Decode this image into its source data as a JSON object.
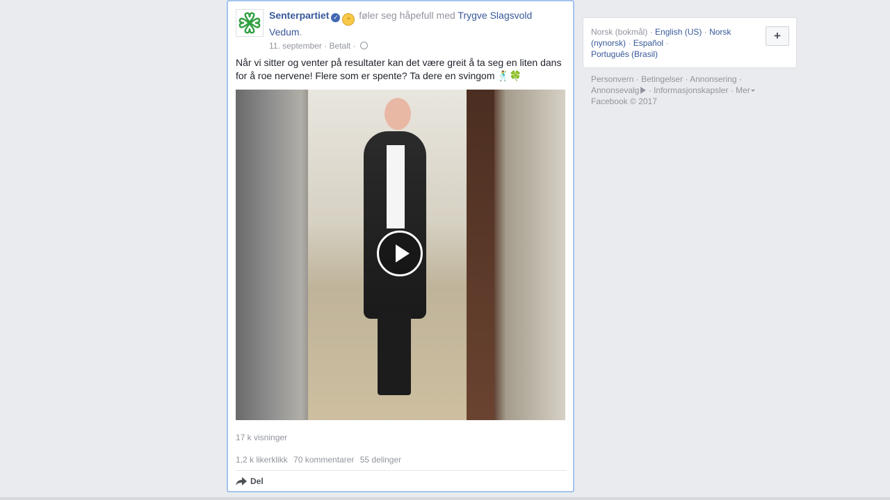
{
  "post": {
    "page_name": "Senterpartiet",
    "feeling_text": "føler seg håpefull med",
    "tagged_person": "Trygve Slagsvold Vedum",
    "tagged_suffix": ".",
    "date": "11. september",
    "sponsored": "Betalt",
    "dot": "·",
    "text": "Når vi sitter og venter på resultater kan det være greit å ta seg en liten dans for å roe nervene! Flere som er spente? Ta dere en svingom 🕺🍀",
    "views": "17 k visninger",
    "likes": "1,2 k likerklikk",
    "comments": "70 kommentarer",
    "shares": "55 delinger",
    "share_label": "Del",
    "icons": {
      "avatar": "clover-logo-icon",
      "verified": "verified-badge-icon",
      "feeling": "laughing-emoji-icon",
      "audience": "globe-icon",
      "play": "play-icon",
      "share": "share-arrow-icon"
    }
  },
  "languages": {
    "current": "Norsk (bokmål)",
    "items": [
      "English (US)",
      "Norsk (nynorsk)",
      "Español",
      "Português (Brasil)"
    ],
    "separator": "·",
    "add_label": "+"
  },
  "footer": {
    "links": [
      "Personvern",
      "Betingelser",
      "Annonsering",
      "Annonsevalg",
      "Informasjonskapsler",
      "Mer"
    ],
    "copyright": "Facebook © 2017",
    "separator": "·"
  },
  "colors": {
    "background": "#e9ebee",
    "link": "#365899",
    "muted": "#90949c",
    "post_highlight_border": "#a3c4f0",
    "clover_green": "#2e9e3e"
  }
}
